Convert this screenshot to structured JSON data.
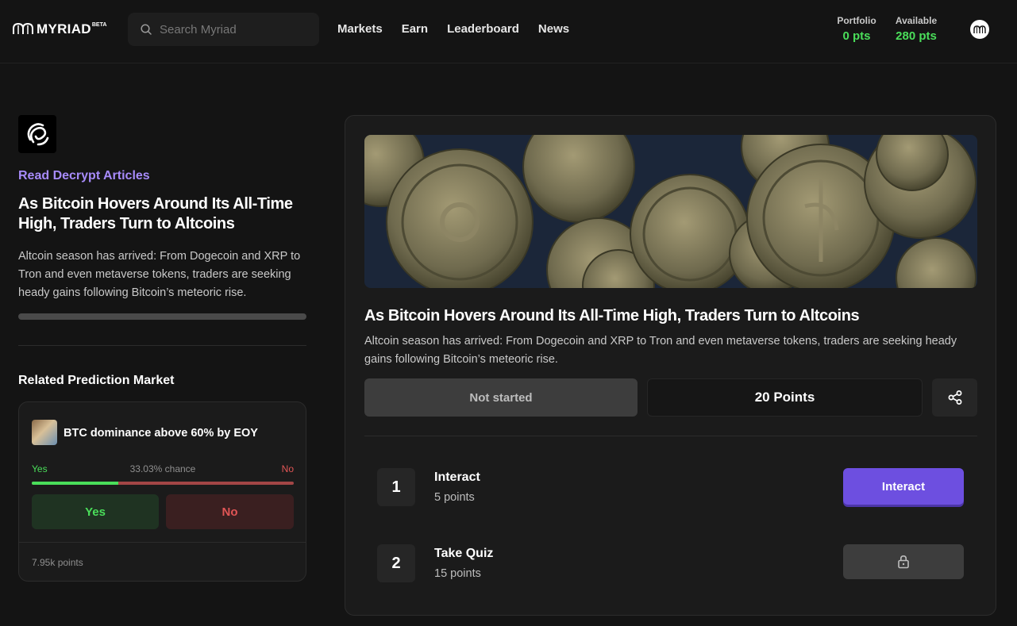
{
  "header": {
    "logo_text": "MYRIAD",
    "logo_badge": "BETA",
    "search_placeholder": "Search Myriad",
    "nav": [
      "Markets",
      "Earn",
      "Leaderboard",
      "News"
    ],
    "portfolio": {
      "label": "Portfolio",
      "value": "0 pts"
    },
    "available": {
      "label": "Available",
      "value": "280 pts"
    }
  },
  "sidebar": {
    "link_label": "Read Decrypt Articles",
    "title": "As Bitcoin Hovers Around Its All-Time High, Traders Turn to Altcoins",
    "description": "Altcoin season has arrived: From Dogecoin and XRP to Tron and even metaverse tokens, traders are seeking heady gains following Bitcoin’s meteoric rise.",
    "reading_progress": 0,
    "related_heading": "Related Prediction Market",
    "market": {
      "title": "BTC dominance above 60% by EOY",
      "yes_label": "Yes",
      "no_label": "No",
      "chance": "33.03% chance",
      "yes_fraction": 0.3303,
      "yes_button": "Yes",
      "no_button": "No",
      "points": "7.95k points"
    }
  },
  "article": {
    "title": "As Bitcoin Hovers Around Its All-Time High, Traders Turn to Altcoins",
    "description": "Altcoin season has arrived: From Dogecoin and XRP to Tron and even metaverse tokens, traders are seeking heady gains following Bitcoin’s meteoric rise.",
    "status": "Not started",
    "points": "20 Points",
    "tasks": [
      {
        "number": "1",
        "title": "Interact",
        "points": "5 points",
        "action": "Interact"
      },
      {
        "number": "2",
        "title": "Take Quiz",
        "points": "15 points",
        "locked": true
      }
    ]
  },
  "colors": {
    "accent_purple": "#6d4fe0",
    "link_purple": "#a78bfa",
    "green": "#4ade5a",
    "red": "#e05555",
    "background": "#141414",
    "card": "#1b1b1b"
  },
  "icons": [
    "myriad-logo-icon",
    "search-icon",
    "avatar-icon",
    "decrypt-logo-icon",
    "share-icon",
    "lock-icon"
  ]
}
